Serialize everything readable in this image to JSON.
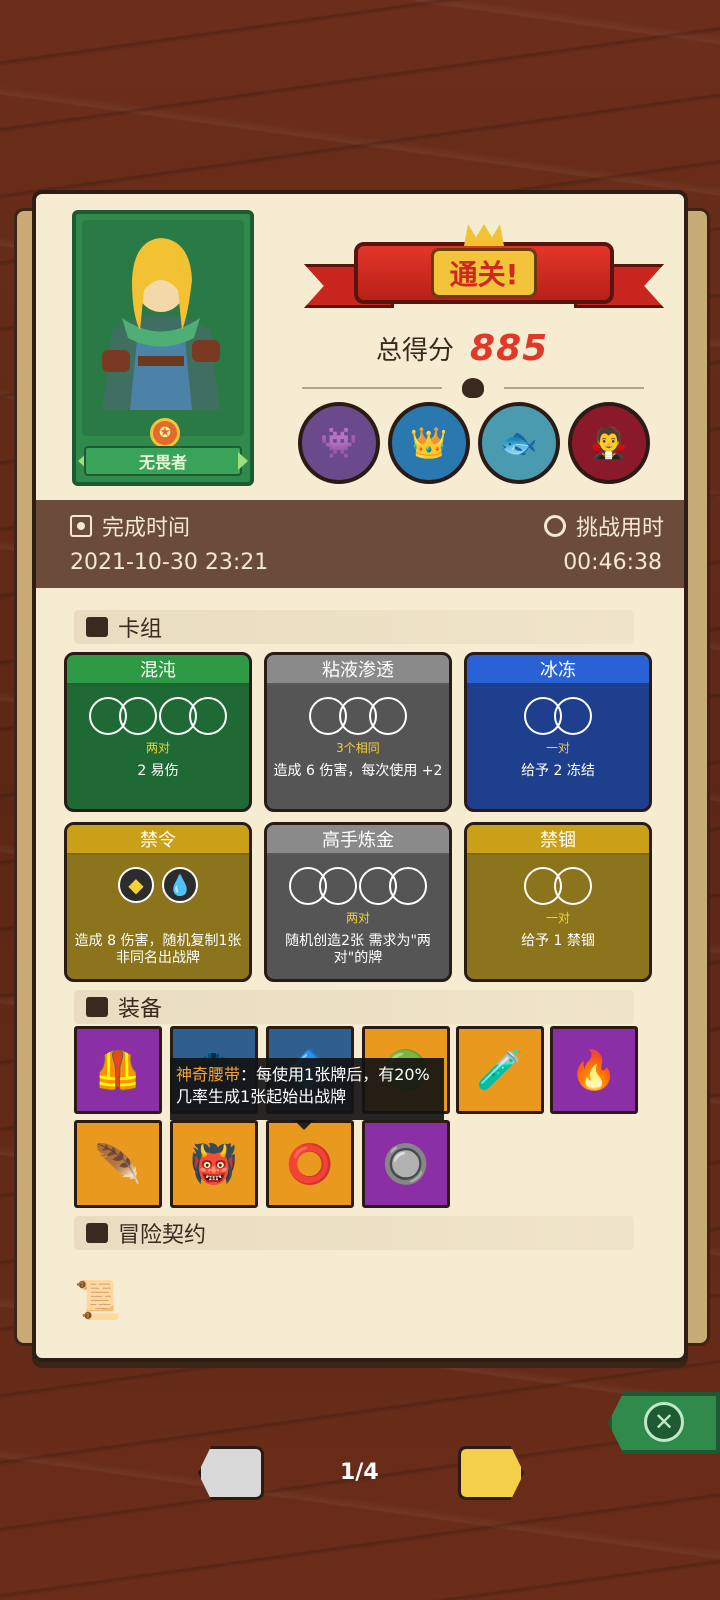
{
  "hero": {
    "name": "无畏者"
  },
  "result": {
    "title": "通关!",
    "score_label": "总得分",
    "score_value": "885"
  },
  "bosses": [
    {
      "icon": "golem-boss-icon",
      "emoji": "👾",
      "bg": "#6a4a8a"
    },
    {
      "icon": "crown-cyclops-boss-icon",
      "emoji": "👑",
      "bg": "#2a78b0"
    },
    {
      "icon": "fish-boss-icon",
      "emoji": "🐟",
      "bg": "#4a9ab0"
    },
    {
      "icon": "vampire-boss-icon",
      "emoji": "🧛",
      "bg": "#8a1a2a"
    }
  ],
  "info": {
    "finish_label": "完成时间",
    "finish_value": "2021-10-30 23:21",
    "duration_label": "挑战用时",
    "duration_value": "00:46:38"
  },
  "sections": {
    "deck": "卡组",
    "equipment": "装备",
    "contract": "冒险契约"
  },
  "combos": [
    {
      "name": "混沌",
      "sub": "两对",
      "desc": "2 易伤",
      "color": "green"
    },
    {
      "name": "粘液渗透",
      "sub": "3个相同",
      "desc": "造成 6 伤害，每次使用 +2",
      "color": "gray"
    },
    {
      "name": "冰冻",
      "sub": "一对",
      "desc": "给予 2 冻结",
      "color": "blue"
    },
    {
      "name": "禁令",
      "sub": "",
      "desc": "造成 8 伤害，随机复制1张非同名出战牌",
      "color": "gold"
    },
    {
      "name": "高手炼金",
      "sub": "两对",
      "desc": "随机创造2张 需求为\"两对\"的牌",
      "color": "gray"
    },
    {
      "name": "禁锢",
      "sub": "一对",
      "desc": "给予 1 禁锢",
      "color": "gold"
    }
  ],
  "equipment": [
    {
      "icon": "vest-icon",
      "glyph": "🦺",
      "color": "#8a2fa6"
    },
    {
      "icon": "cape-icon",
      "glyph": "🧥",
      "color": "#2e5f8d"
    },
    {
      "icon": "spike-icon",
      "glyph": "🔷",
      "color": "#2e5f8d"
    },
    {
      "icon": "orb-icon",
      "glyph": "🟢",
      "color": "#e99a1e"
    },
    {
      "icon": "potion-icon",
      "glyph": "🧪",
      "color": "#e99a1e"
    },
    {
      "icon": "fire-gem-icon",
      "glyph": "🔥",
      "color": "#8a2fa6"
    },
    {
      "icon": "feather-icon",
      "glyph": "🪶",
      "color": "#e99a1e"
    },
    {
      "icon": "demon-mask-icon",
      "glyph": "👹",
      "color": "#e99a1e"
    },
    {
      "icon": "magic-belt-icon",
      "glyph": "⭕",
      "color": "#e99a1e"
    },
    {
      "icon": "button-icon",
      "glyph": "🔘",
      "color": "#8a2fa6"
    }
  ],
  "tooltip": {
    "name": "神奇腰带",
    "text": "：每使用1张牌后，有20%几率生成1张起始出战牌"
  },
  "pager": {
    "text": "1/4"
  }
}
